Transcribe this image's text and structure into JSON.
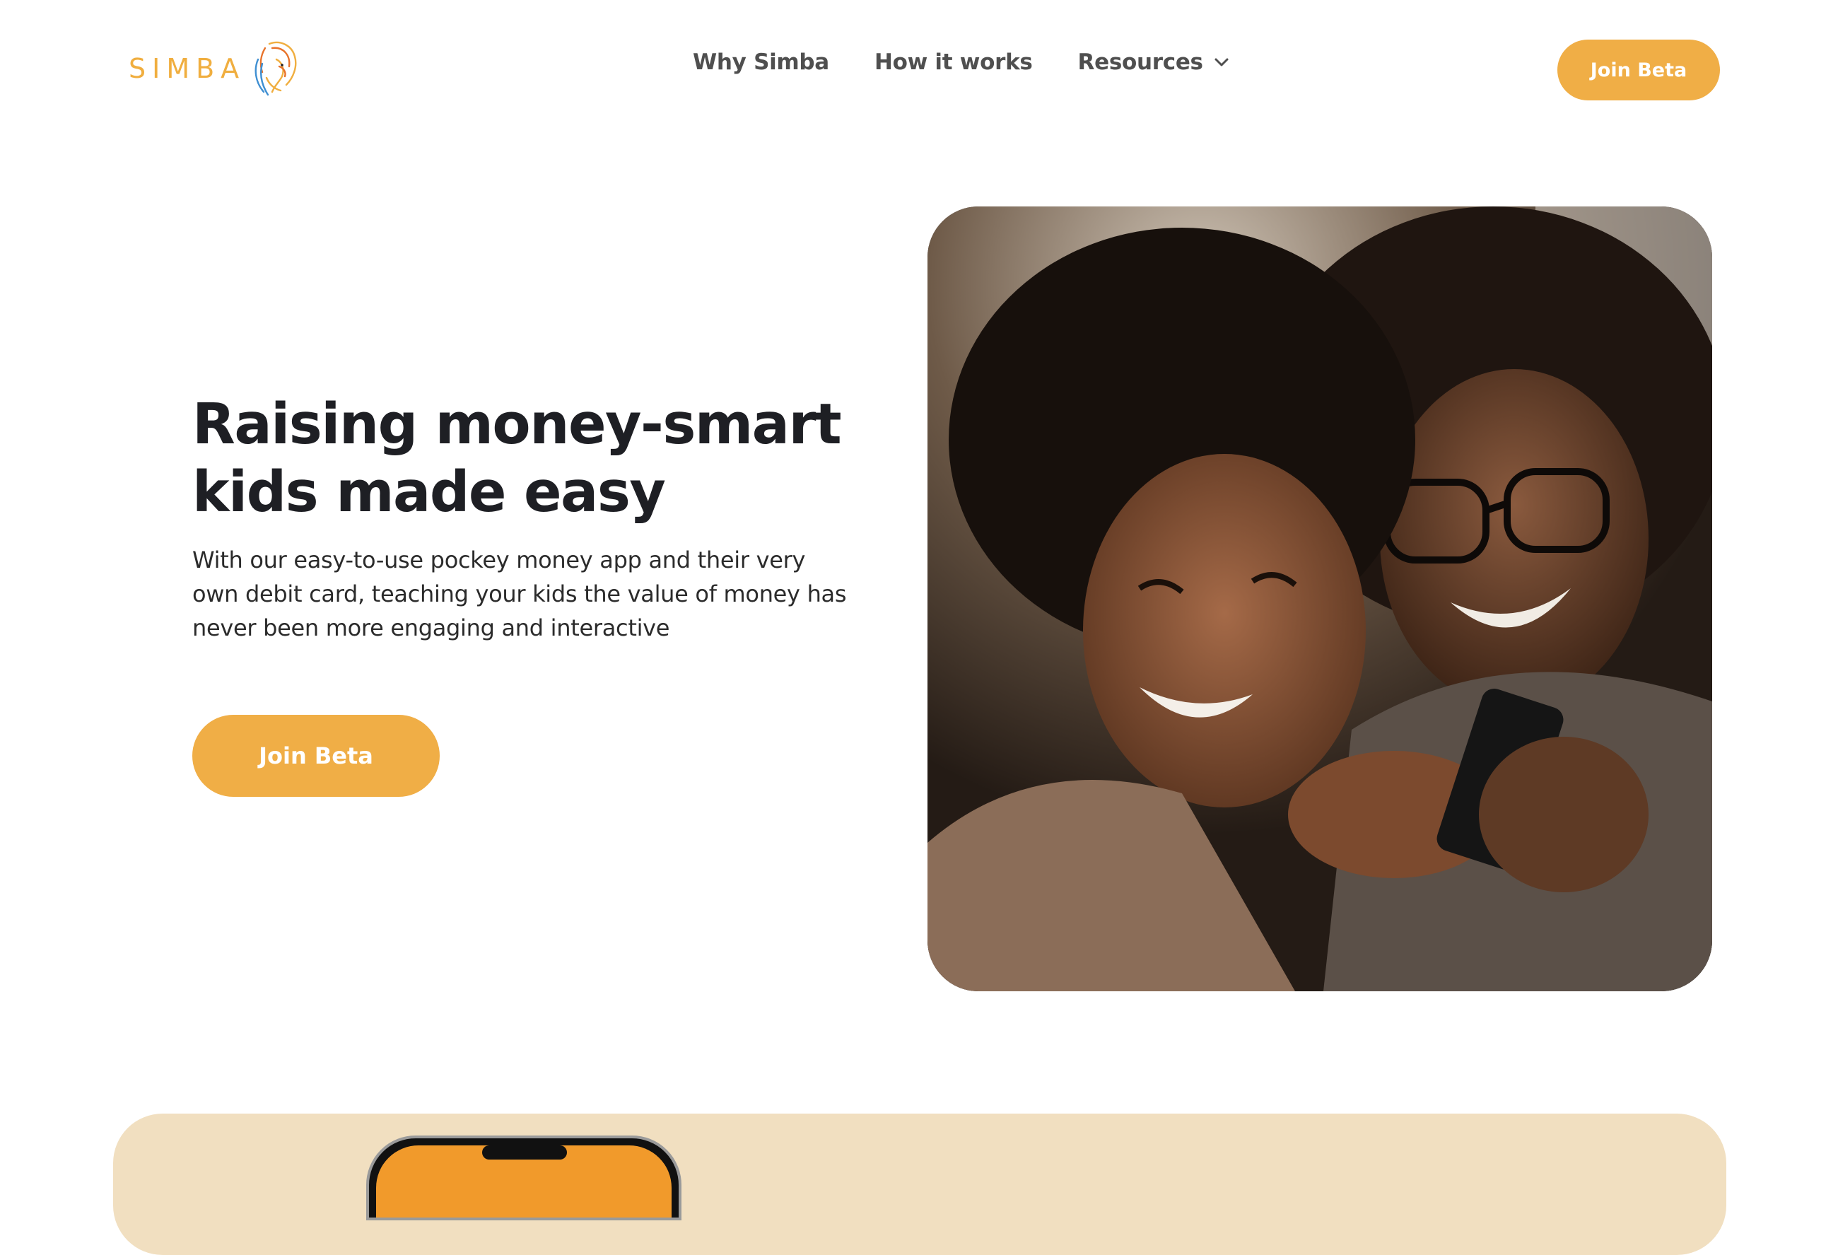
{
  "header": {
    "logo_text": "SIMBA",
    "logo_icon": "lion-icon",
    "nav": [
      {
        "label": "Why Simba"
      },
      {
        "label": "How it works"
      },
      {
        "label": "Resources",
        "icon": "chevron-down-icon"
      }
    ],
    "cta_label": "Join Beta"
  },
  "hero": {
    "title": "Raising money-smart kids made easy",
    "subtitle": "With our easy-to-use pockey money app and their very own debit card, teaching your kids the value of money has never been more engaging and interactive",
    "cta_label": "Join Beta"
  },
  "colors": {
    "accent": "#f0ae46",
    "band": "#f1dfc0",
    "title": "#1e1f24",
    "nav_text": "#4f4f4f"
  }
}
